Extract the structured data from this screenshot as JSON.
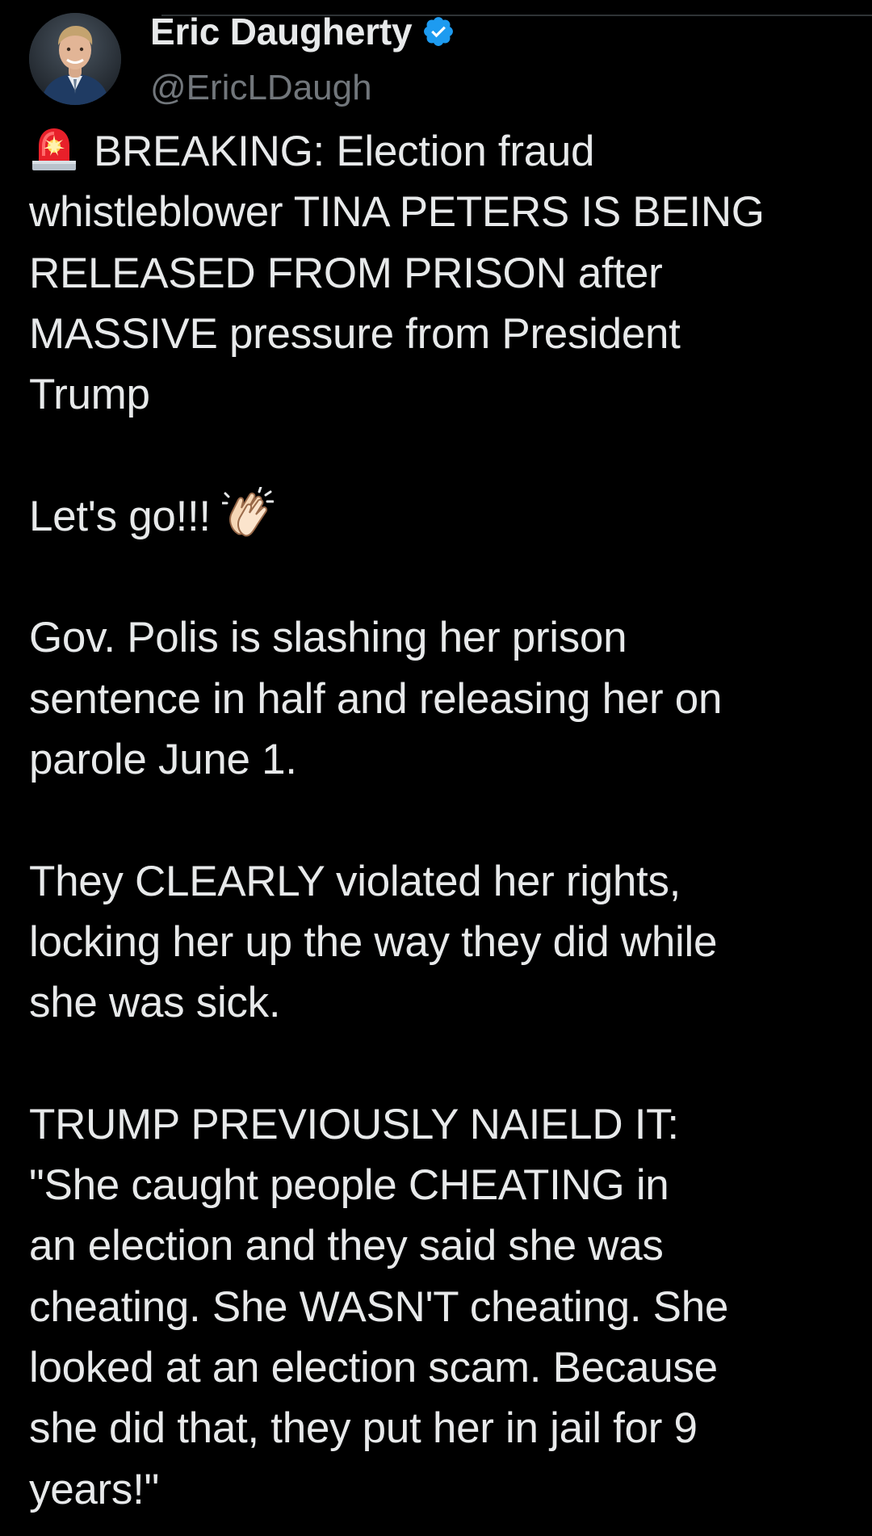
{
  "author": {
    "display_name": "Eric Daugherty",
    "handle": "@EricLDaugh",
    "verified": true
  },
  "tweet": {
    "headline_icon": "police-light-icon",
    "paragraphs": [
      "BREAKING: Election fraud\nwhistleblower TINA PETERS IS BEING\nRELEASED FROM PRISON after\nMASSIVE pressure from President\nTrump",
      "Let's go!!!",
      "Gov. Polis is slashing her prison\nsentence in half and releasing her on\nparole June 1.",
      "They CLEARLY violated her rights,\nlocking her up the way they did while\nshe was sick.",
      "TRUMP PREVIOUSLY NAIELD IT:\n\"She caught people CHEATING in\nan election and they said she was\ncheating. She WASN'T cheating. She\nlooked at an election scam. Because\nshe did that, they put her in jail for 9\nyears!\""
    ],
    "emoji_after_paragraph_2": "clapping-hands-icon"
  },
  "colors": {
    "background": "#000000",
    "text": "#e7e9ea",
    "secondary_text": "#71767b",
    "verified_badge": "#1d9bf0"
  }
}
